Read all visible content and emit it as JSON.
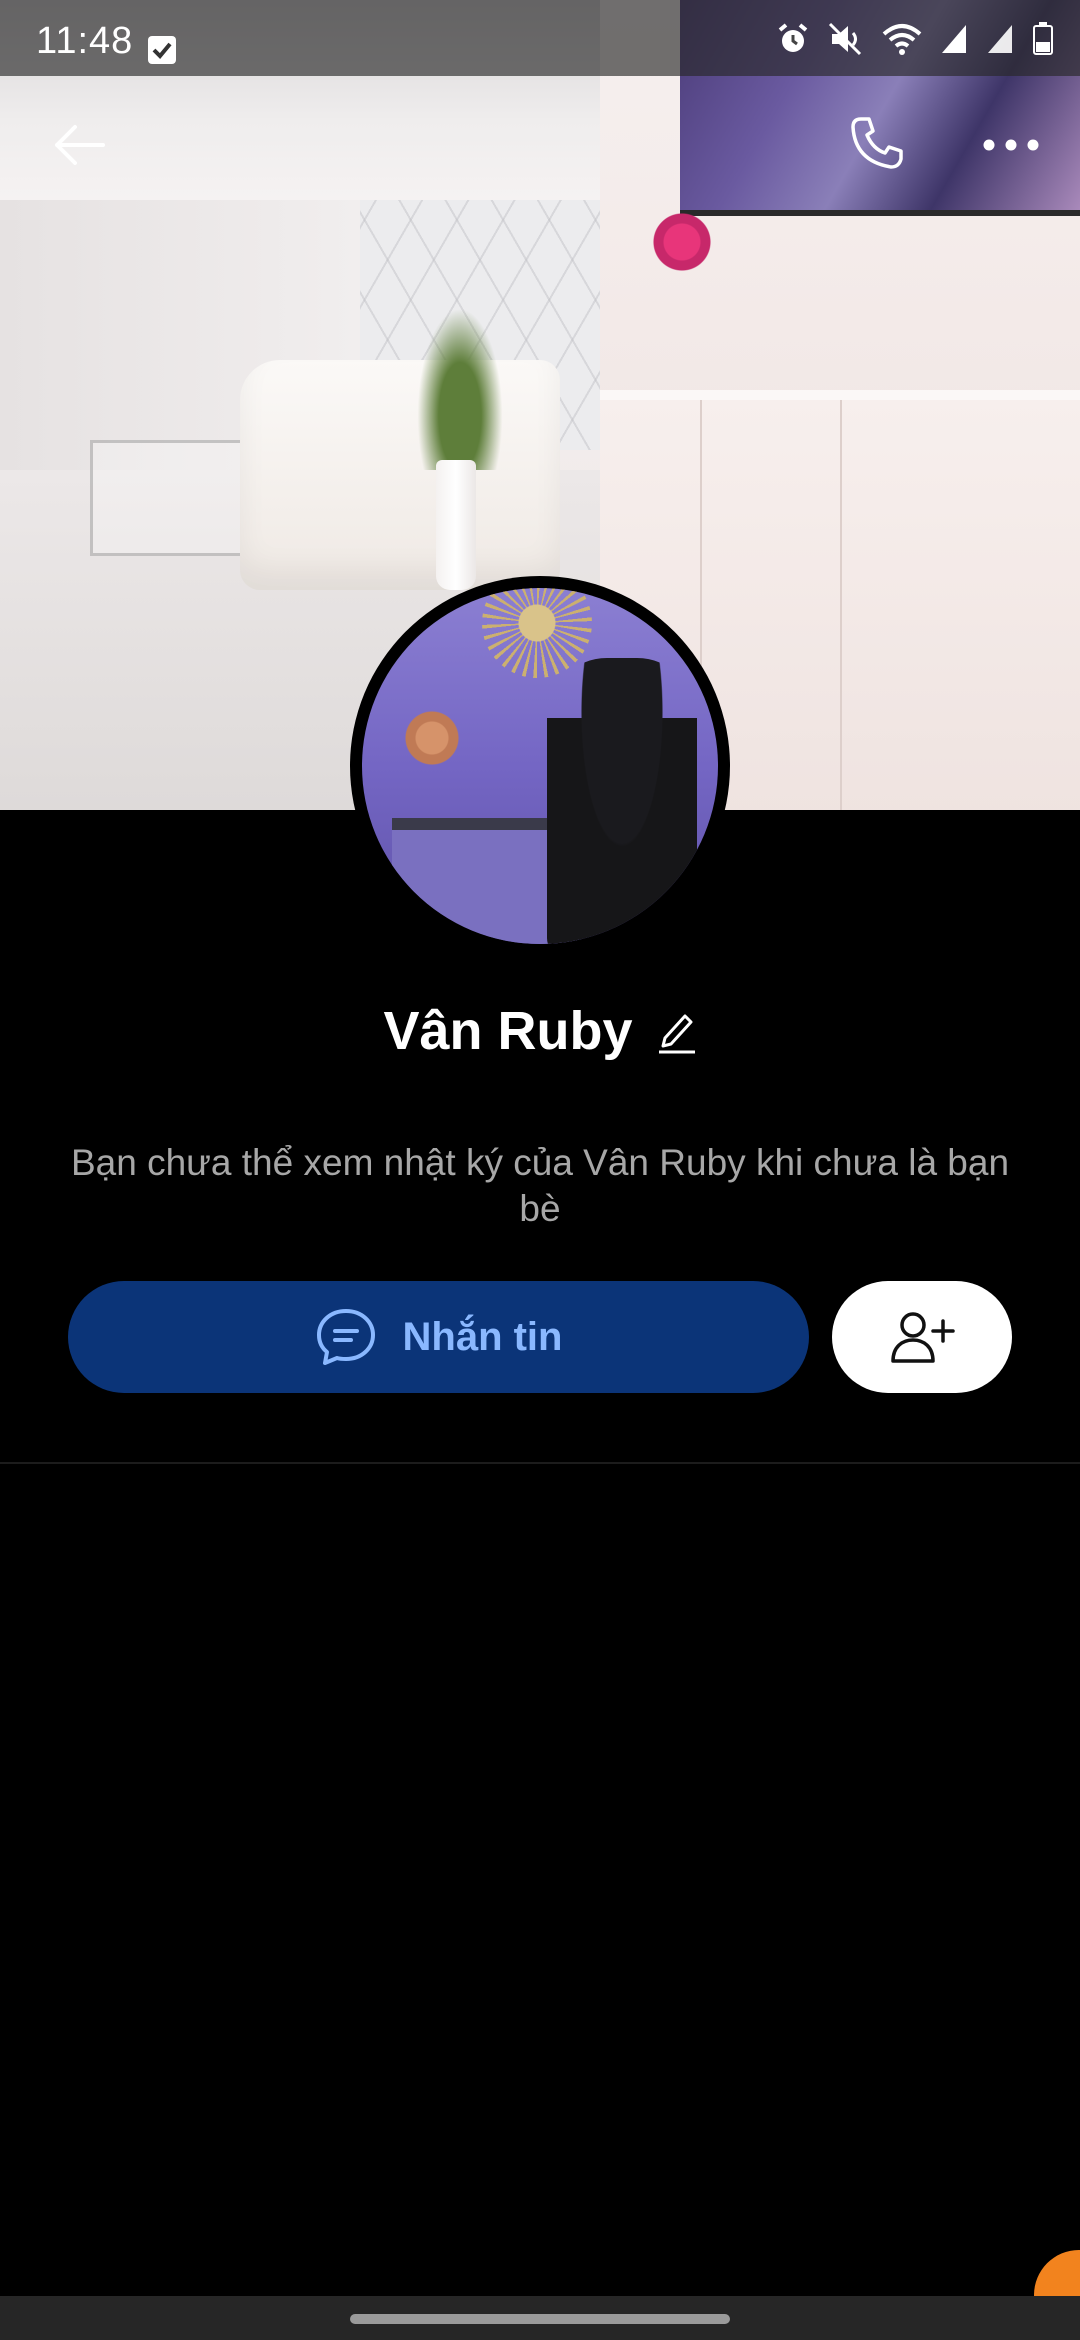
{
  "status_bar": {
    "time": "11:48",
    "icons": [
      "checkbox-icon",
      "alarm-icon",
      "mute-icon",
      "wifi-icon",
      "signal-icon",
      "signal-icon-2",
      "battery-icon"
    ]
  },
  "header": {
    "back_icon": "arrow-left-icon",
    "call_icon": "phone-icon",
    "more_icon": "more-horizontal-icon"
  },
  "profile": {
    "name": "Vân Ruby",
    "edit_icon": "pencil-icon",
    "notice": "Bạn chưa thể xem nhật ký của Vân Ruby khi chưa là bạn bè"
  },
  "actions": {
    "message_label": "Nhắn tin",
    "message_icon": "chat-bubble-icon",
    "add_friend_icon": "add-user-icon"
  },
  "colors": {
    "background": "#000000",
    "message_button": "#0b3478",
    "message_text": "#8ab8ff",
    "notice_text": "#a7a7a7",
    "floating_bubble": "#f2831e"
  }
}
